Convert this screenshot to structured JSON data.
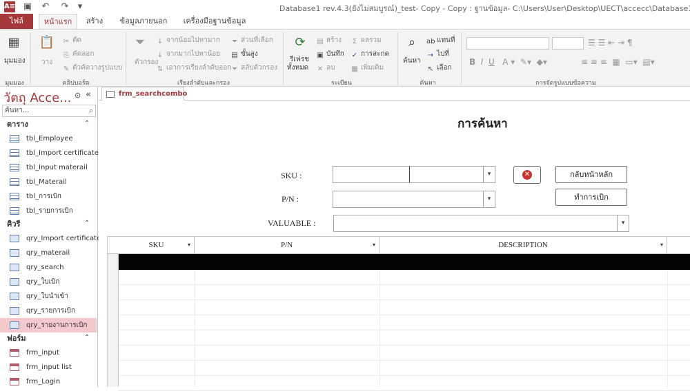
{
  "titlebar": {
    "app_icon": "A≡",
    "title": "Database1 rev.4.3(ยังไม่สมบูรณ์)_test- Copy - Copy : ฐานข้อมูล- C:\\Users\\User\\Desktop\\UECT\\accecc\\Database1 rev.4.3(ยังไม่สมบูรณ์)"
  },
  "tabs": {
    "file": "ไฟล์",
    "home": "หน้าแรก",
    "create": "สร้าง",
    "external": "ข้อมูลภายนอก",
    "dbtools": "เครื่องมือฐานข้อมูล"
  },
  "ribbon": {
    "views": {
      "view": "มุมมอง",
      "label": "มุมมอง"
    },
    "clipboard": {
      "paste": "วาง",
      "cut": "ตัด",
      "copy": "คัดลอก",
      "format_painter": "ตัวคัดวางรูปแบบ",
      "label": "คลิปบอร์ด"
    },
    "sort": {
      "filter": "ตัวกรอง",
      "asc": "จากน้อยไปหามาก",
      "desc": "จากมากไปหาน้อย",
      "remove": "เอาการเรียงลำดับออก",
      "selection": "ส่วนที่เลือก",
      "advanced": "ขั้นสูง",
      "toggle": "สลับตัวกรอง",
      "label": "เรียงลำดับและกรอง"
    },
    "records": {
      "refresh": "รีเฟรช",
      "refresh2": "ทั้งหมด",
      "new": "สร้าง",
      "save": "บันทึก",
      "delete": "ลบ",
      "totals": "ผลรวม",
      "spelling": "การสะกด",
      "more": "เพิ่มเติม",
      "label": "ระเบียน"
    },
    "find": {
      "find": "ค้นหา",
      "replace": "แทนที่",
      "goto": "ไปที่",
      "select": "เลือก",
      "label": "ค้นหา"
    },
    "format": {
      "label": "การจัดรูปแบบข้อความ"
    }
  },
  "nav": {
    "title": "วัตถุ Acce...",
    "search_placeholder": "ค้นหา...",
    "sections": [
      {
        "label": "ตาราง",
        "items": [
          "tbl_Employee",
          "tbl_Import certificate",
          "tbl_Input materail",
          "tbl_Materail",
          "tbl_การเบิก",
          "tbl_รายการเบิก"
        ]
      },
      {
        "label": "คิวรี",
        "items": [
          "qry_Import certificate",
          "qry_materail",
          "qry_search",
          "qry_ใบเบิก",
          "qry_ใบนำเข้า",
          "qry_รายการเบิก",
          "qry_รายงานการเบิก"
        ]
      },
      {
        "label": "ฟอร์ม",
        "items": [
          "frm_input",
          "frm_input list",
          "frm_Login"
        ]
      }
    ]
  },
  "doc_tab": "frm_searchcombo",
  "form": {
    "title": "การค้นหา",
    "sku_label": "SKU :",
    "pn_label": "P/N :",
    "valuable_label": "VALUABLE :",
    "back_button": "กลับหน้าหลัก",
    "withdraw_button": "ทำการเบิก"
  },
  "grid": {
    "columns": [
      "SKU",
      "P/N",
      "DESCRIPTION"
    ]
  },
  "colors": {
    "accent": "#a4373a",
    "selected_nav": "#f3c9cc",
    "close_button": "#c8332c"
  }
}
